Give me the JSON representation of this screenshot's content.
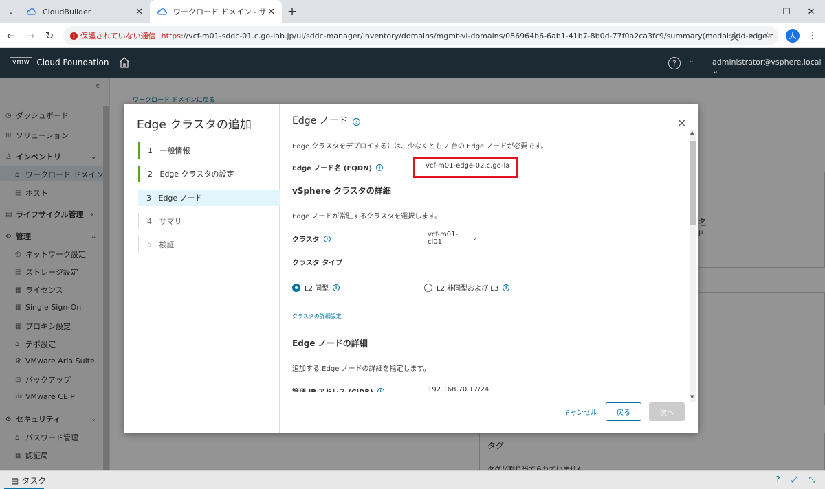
{
  "browser": {
    "tabs": [
      {
        "title": "CloudBuilder",
        "icon": "cloud-icon"
      },
      {
        "title": "ワークロード ドメイン - サマリ",
        "icon": "cloud-icon"
      }
    ],
    "new_tab": "+",
    "security_label": "保護されていない通信",
    "url_scheme": "https",
    "url_rest": "://vcf-m01-sddc-01.c.go-lab.jp/ui/sddc-manager/inventory/domains/mgmt-vi-domains/086964b6-6ab1-41b7-8b0d-77f0a2ca3fc9/summary(modal:add-edge-c...",
    "profile_initial": "人"
  },
  "header": {
    "vmw": "vmw",
    "product": "Cloud Foundation",
    "help": "?",
    "user": "administrator@vsphere.local"
  },
  "sidebar": {
    "collapse": "«",
    "items": [
      {
        "label": "ダッシュボード"
      },
      {
        "label": "ソリューション"
      },
      {
        "label": "インベントリ"
      },
      {
        "label": "ワークロード ドメイン"
      },
      {
        "label": "ホスト"
      },
      {
        "label": "ライフサイクル管理"
      },
      {
        "label": "管理"
      },
      {
        "label": "ネットワーク設定"
      },
      {
        "label": "ストレージ設定"
      },
      {
        "label": "ライセンス"
      },
      {
        "label": "Single Sign-On"
      },
      {
        "label": "プロキシ設定"
      },
      {
        "label": "デポ設定"
      },
      {
        "label": "VMware Aria Suite"
      },
      {
        "label": "バックアップ"
      },
      {
        "label": "VMware CEIP"
      },
      {
        "label": "セキュリティ"
      },
      {
        "label": "パスワード管理"
      },
      {
        "label": "認証局"
      }
    ]
  },
  "background": {
    "breadcrumb": "ワークロード ドメインに戻る",
    "partial_name": "名",
    "partial_name2": "p",
    "tag_label": "タグ",
    "tag_sub": "タグが割り当てられていません"
  },
  "taskbar": {
    "label": "タスク"
  },
  "modal": {
    "title": "Edge クラスタの追加",
    "steps": [
      {
        "num": "1",
        "label": "一般情報"
      },
      {
        "num": "2",
        "label": "Edge クラスタの設定"
      },
      {
        "num": "3",
        "label": "Edge ノード"
      },
      {
        "num": "4",
        "label": "サマリ"
      },
      {
        "num": "5",
        "label": "検証"
      }
    ],
    "section_title": "Edge ノード",
    "intro": "Edge クラスタをデプロイするには、少なくとも 2 台の Edge ノードが必要です。",
    "fqdn_label": "Edge ノード名 (FQDN)",
    "fqdn_value": "vcf-m01-edge-02.c.go-la",
    "vsphere_title": "vSphere クラスタの詳細",
    "vsphere_desc": "Edge ノードが常駐するクラスタを選択します。",
    "cluster_label": "クラスタ",
    "cluster_value": "vcf-m01-cl01",
    "cluster_type_label": "クラスタ タイプ",
    "radio_l2": "L2 同型",
    "radio_l3": "L2 非同型および L3",
    "advanced_link": "クラスタの詳細設定",
    "node_details_title": "Edge ノードの詳細",
    "node_details_desc": "追加する Edge ノードの詳細を指定します。",
    "mgmt_ip_label": "管理 IP アドレス (CIDR)",
    "mgmt_ip_value": "192.168.70.17/24",
    "cancel": "キャンセル",
    "back": "戻る",
    "next": "次へ",
    "close": "×"
  },
  "colors": {
    "accent": "#0072a3",
    "header_bg": "#1c2a33",
    "highlight": "#e0141e",
    "step_done": "#5aa220"
  }
}
